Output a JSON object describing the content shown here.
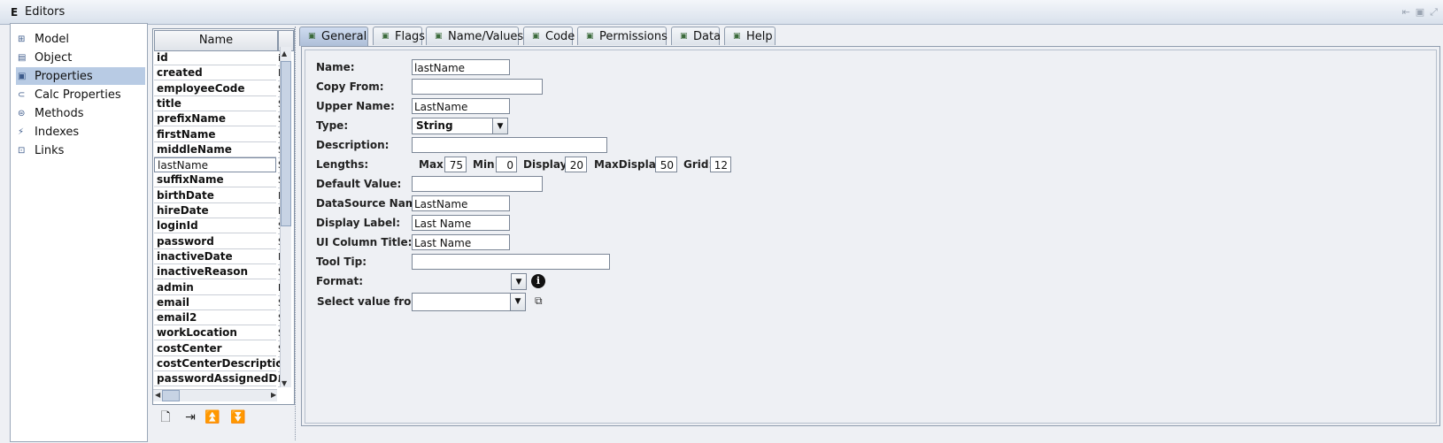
{
  "window": {
    "title": "Editors",
    "title_icon": "E"
  },
  "nav": {
    "items": [
      {
        "label": "Model",
        "icon": "model-icon",
        "glyph": "⊞"
      },
      {
        "label": "Object",
        "icon": "object-icon",
        "glyph": "▤"
      },
      {
        "label": "Properties",
        "icon": "properties-icon",
        "glyph": "▣",
        "selected": true
      },
      {
        "label": "Calc Properties",
        "icon": "calc-properties-icon",
        "glyph": "⊂"
      },
      {
        "label": "Methods",
        "icon": "methods-icon",
        "glyph": "⊜"
      },
      {
        "label": "Indexes",
        "icon": "indexes-icon",
        "glyph": "⚡"
      },
      {
        "label": "Links",
        "icon": "links-icon",
        "glyph": "⊡"
      }
    ]
  },
  "property_list": {
    "column_header": "Name",
    "column2_header": "",
    "rows": [
      {
        "name": "id",
        "type": "in"
      },
      {
        "name": "created",
        "type": "D"
      },
      {
        "name": "employeeCode",
        "type": "S"
      },
      {
        "name": "title",
        "type": "S"
      },
      {
        "name": "prefixName",
        "type": "S"
      },
      {
        "name": "firstName",
        "type": "S"
      },
      {
        "name": "middleName",
        "type": "S"
      },
      {
        "name": "lastName",
        "type": "S"
      },
      {
        "name": "suffixName",
        "type": "S"
      },
      {
        "name": "birthDate",
        "type": "D"
      },
      {
        "name": "hireDate",
        "type": "D"
      },
      {
        "name": "loginId",
        "type": "S"
      },
      {
        "name": "password",
        "type": "S"
      },
      {
        "name": "inactiveDate",
        "type": "D"
      },
      {
        "name": "inactiveReason",
        "type": "S"
      },
      {
        "name": "admin",
        "type": "b"
      },
      {
        "name": "email",
        "type": "S"
      },
      {
        "name": "email2",
        "type": "S"
      },
      {
        "name": "workLocation",
        "type": "S"
      },
      {
        "name": "costCenter",
        "type": "S"
      },
      {
        "name": "costCenterDescription",
        "type": "S"
      },
      {
        "name": "passwordAssignedD...",
        "type": "D"
      }
    ],
    "selected_index": 7
  },
  "toolbar": {
    "buttons": [
      {
        "name": "new-icon",
        "glyph": "🗋"
      },
      {
        "name": "insert-icon",
        "glyph": "⇥"
      },
      {
        "name": "move-top-icon",
        "glyph": "⏫"
      },
      {
        "name": "move-bottom-icon",
        "glyph": "⏬"
      }
    ]
  },
  "tabs": [
    {
      "label": "General",
      "active": true
    },
    {
      "label": "Flags"
    },
    {
      "label": "Name/Values"
    },
    {
      "label": "Code"
    },
    {
      "label": "Permissions"
    },
    {
      "label": "Data"
    },
    {
      "label": "Help"
    }
  ],
  "form": {
    "name_label": "Name:",
    "name_value": "lastName",
    "copy_from_label": "Copy From:",
    "copy_from_value": "",
    "upper_name_label": "Upper Name:",
    "upper_name_value": "LastName",
    "type_label": "Type:",
    "type_value": "String",
    "description_label": "Description:",
    "description_value": "",
    "lengths_label": "Lengths:",
    "max_label": "Max:",
    "max_value": "75",
    "min_label": "Min:",
    "min_value": "0",
    "display_label": "Display:",
    "display_value": "20",
    "maxdisplay_label": "MaxDisplay:",
    "maxdisplay_value": "50",
    "grid_label": "Grid:",
    "grid_value": "12",
    "default_value_label": "Default Value:",
    "default_value_value": "",
    "datasource_label": "DataSource Name:",
    "datasource_value": "LastName",
    "display_label_label": "Display Label:",
    "display_label_value": "Last Name",
    "ui_column_title_label": "UI Column Title:",
    "ui_column_title_value": "Last Name",
    "tooltip_label": "Tool Tip:",
    "tooltip_value": "",
    "format_label": "Format:",
    "format_value": "",
    "select_value_label": "Select value from:",
    "select_value_value": ""
  }
}
